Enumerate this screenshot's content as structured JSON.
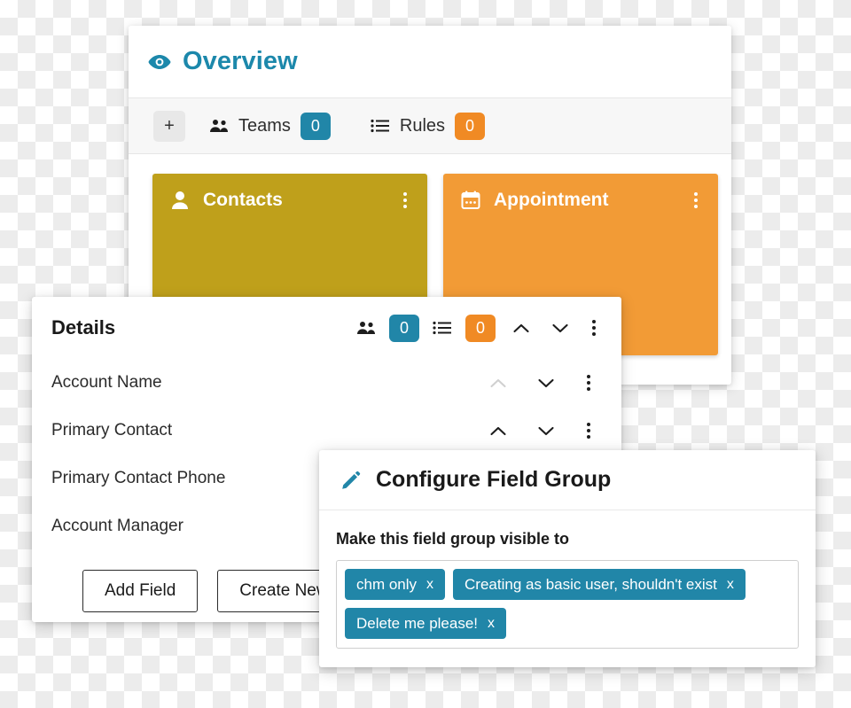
{
  "overview": {
    "title": "Overview",
    "icon": "eye-icon",
    "toolbar": {
      "add_label": "+",
      "items": [
        {
          "icon": "people-icon",
          "label": "Teams",
          "count": "0",
          "color": "#2186a8"
        },
        {
          "icon": "list-icon",
          "label": "Rules",
          "count": "0",
          "color": "#f08a24"
        }
      ]
    },
    "cards": [
      {
        "title": "Contacts",
        "icon": "person-icon",
        "color": "#bfa01b",
        "menu": "kebab-icon"
      },
      {
        "title": "Appointment",
        "icon": "calendar-icon",
        "color": "#f29b36",
        "menu": "kebab-icon"
      }
    ]
  },
  "details": {
    "title": "Details",
    "header_controls": {
      "teams_icon": "people-icon",
      "teams_count": "0",
      "teams_color": "#2186a8",
      "rules_icon": "list-icon",
      "rules_count": "0",
      "rules_color": "#f08a24",
      "move_up": "chevron-up-icon",
      "move_down": "chevron-down-icon",
      "menu": "kebab-icon"
    },
    "fields": [
      {
        "label": "Account Name",
        "up_disabled": true
      },
      {
        "label": "Primary Contact",
        "up_disabled": false
      },
      {
        "label": "Primary Contact Phone",
        "up_disabled": false
      },
      {
        "label": "Account Manager",
        "up_disabled": false
      }
    ],
    "buttons": [
      {
        "label": "Add Field"
      },
      {
        "label": "Create New Field"
      }
    ]
  },
  "configure": {
    "title": "Configure Field Group",
    "icon": "pencil-icon",
    "visible_label": "Make this field group visible to",
    "tags": [
      {
        "label": "chm only",
        "remove": "x"
      },
      {
        "label": "Creating as basic user, shouldn't exist",
        "remove": "x"
      },
      {
        "label": "Delete me please!",
        "remove": "x"
      }
    ]
  },
  "colors": {
    "accent_teal": "#1c88ab",
    "badge_teal": "#2186a8",
    "badge_orange": "#f08a24",
    "card_gold": "#bfa01b",
    "card_orange": "#f29b36"
  }
}
